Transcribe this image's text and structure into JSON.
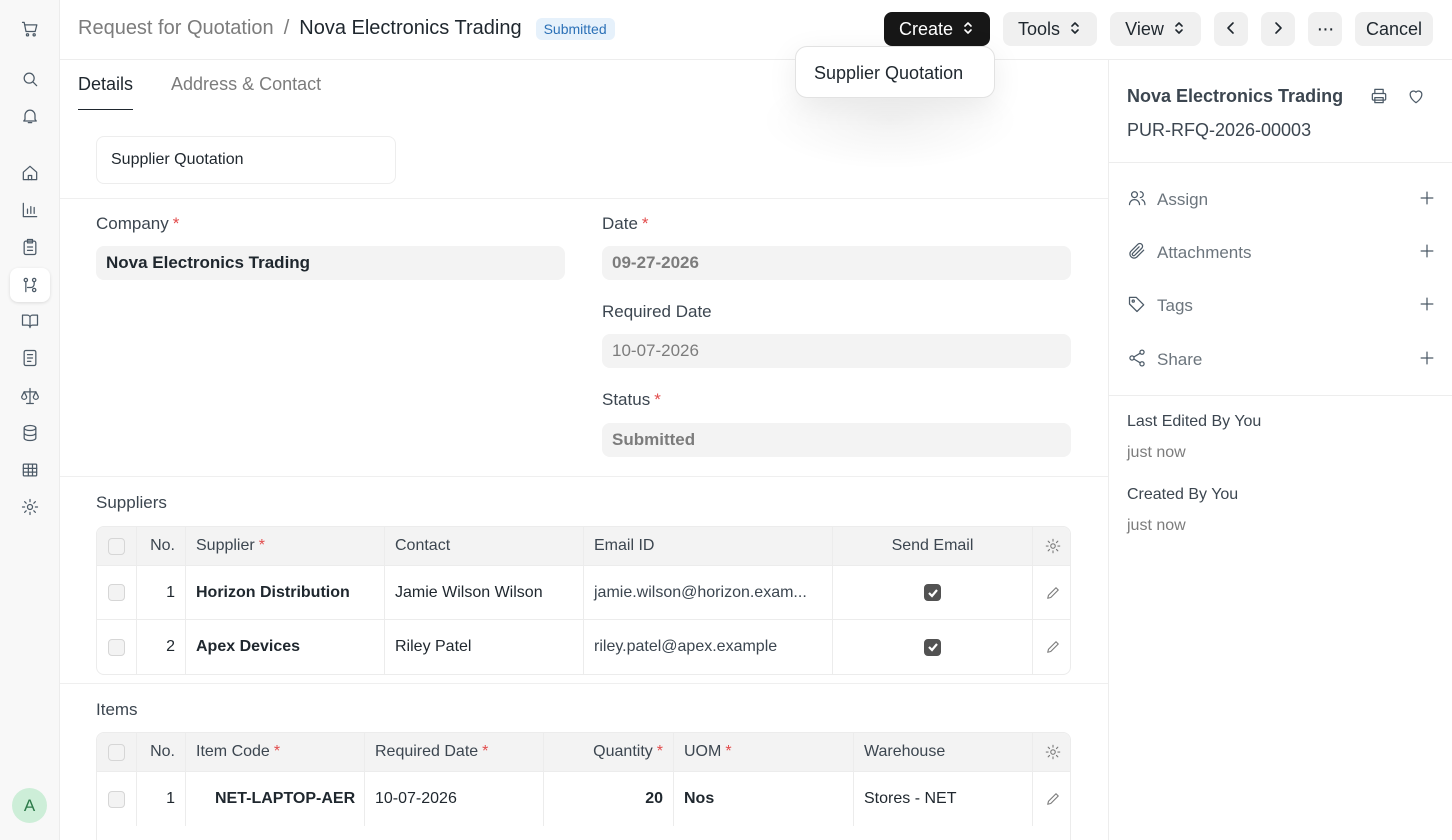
{
  "breadcrumb": {
    "parent": "Request for Quotation",
    "separator": "/",
    "title": "Nova Electronics Trading",
    "status_badge": "Submitted"
  },
  "toolbar": {
    "create": "Create",
    "tools": "Tools",
    "view": "View",
    "cancel": "Cancel"
  },
  "create_menu": {
    "items": [
      "Supplier Quotation"
    ]
  },
  "tabs": [
    "Details",
    "Address & Contact"
  ],
  "quotation_box": "Supplier Quotation",
  "form": {
    "company_label": "Company",
    "company_value": "Nova Electronics Trading",
    "date_label": "Date",
    "date_value": "09-27-2026",
    "required_date_label": "Required Date",
    "required_date_value": "10-07-2026",
    "status_label": "Status",
    "status_value": "Submitted",
    "required_marker": "*"
  },
  "suppliers": {
    "title": "Suppliers",
    "headers": {
      "no": "No.",
      "supplier": "Supplier",
      "contact": "Contact",
      "email": "Email ID",
      "send_email": "Send Email"
    },
    "rows": [
      {
        "no": "1",
        "supplier": "Horizon Distribution",
        "contact": "Jamie Wilson Wilson",
        "email": "jamie.wilson@horizon.exam...",
        "send_email": true
      },
      {
        "no": "2",
        "supplier": "Apex Devices",
        "contact": "Riley Patel",
        "email": "riley.patel@apex.example",
        "send_email": true
      }
    ]
  },
  "items": {
    "title": "Items",
    "headers": {
      "no": "No.",
      "item_code": "Item Code",
      "required_date": "Required Date",
      "quantity": "Quantity",
      "uom": "UOM",
      "warehouse": "Warehouse"
    },
    "rows": [
      {
        "no": "1",
        "item_code": "NET-LAPTOP-AER",
        "required_date": "10-07-2026",
        "quantity": "20",
        "uom": "Nos",
        "warehouse": "Stores - NET"
      }
    ]
  },
  "sidebar_right": {
    "title": "Nova Electronics Trading",
    "doc_id": "PUR-RFQ-2026-00003",
    "actions": [
      "Assign",
      "Attachments",
      "Tags",
      "Share"
    ],
    "last_edited_label": "Last Edited By You",
    "last_edited_value": "just now",
    "created_label": "Created By You",
    "created_value": "just now"
  },
  "user": {
    "avatar_letter": "A"
  },
  "colors": {
    "accent": "#171717",
    "badge_bg": "#e6f1fb",
    "badge_text": "#2c71b7",
    "required": "#e24c4c"
  }
}
